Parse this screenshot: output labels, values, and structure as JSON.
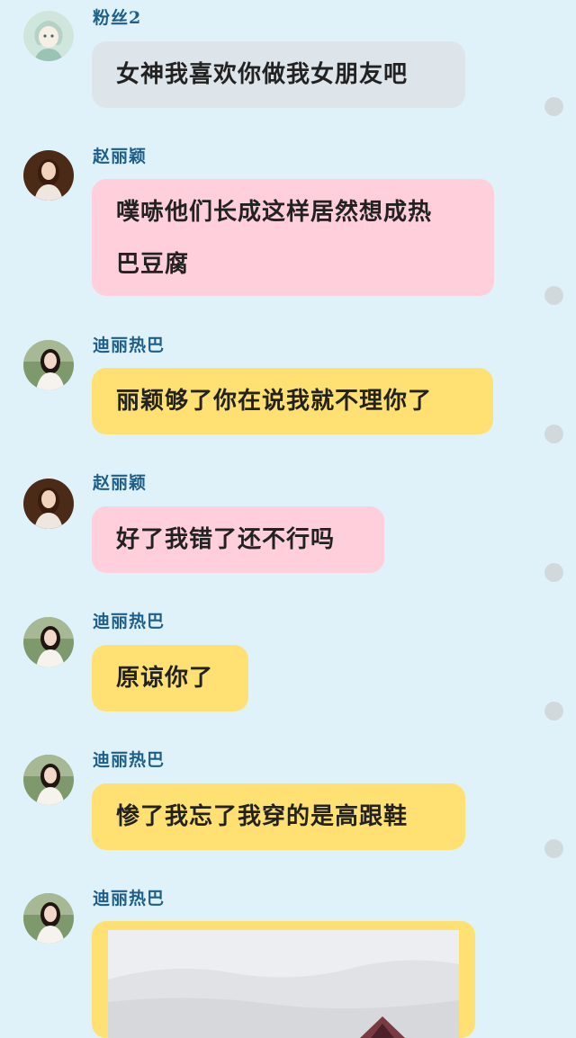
{
  "messages": [
    {
      "sender": "粉丝2",
      "text": "女神我喜欢你做我女朋友吧",
      "style": "gray",
      "avatar": "cartoon-avatar-icon"
    },
    {
      "sender": "赵丽颖",
      "text_lines": [
        "噗哧他们长成这样居然想成热",
        "巴豆腐"
      ],
      "style": "pink",
      "avatar": "woman-portrait-avatar"
    },
    {
      "sender": "迪丽热巴",
      "text": "丽颖够了你在说我就不理你了",
      "style": "yellow",
      "avatar": "woman-portrait-avatar"
    },
    {
      "sender": "赵丽颖",
      "text": "好了我错了还不行吗",
      "style": "pink",
      "avatar": "woman-portrait-avatar"
    },
    {
      "sender": "迪丽热巴",
      "text": "原谅你了",
      "style": "yellow",
      "avatar": "woman-portrait-avatar"
    },
    {
      "sender": "迪丽热巴",
      "text": "惨了我忘了我穿的是高跟鞋",
      "style": "yellow",
      "avatar": "woman-portrait-avatar"
    },
    {
      "sender": "迪丽热巴",
      "image": "photo-message",
      "style": "yellow",
      "avatar": "woman-portrait-avatar"
    }
  ],
  "colors": {
    "background": "#dff2fa",
    "sender_name": "#1d5f8a",
    "gray_bubble": "#dde4ea",
    "pink_bubble": "#ffcfdb",
    "yellow_bubble": "#ffe073",
    "status_dot": "#d2d9dd"
  }
}
